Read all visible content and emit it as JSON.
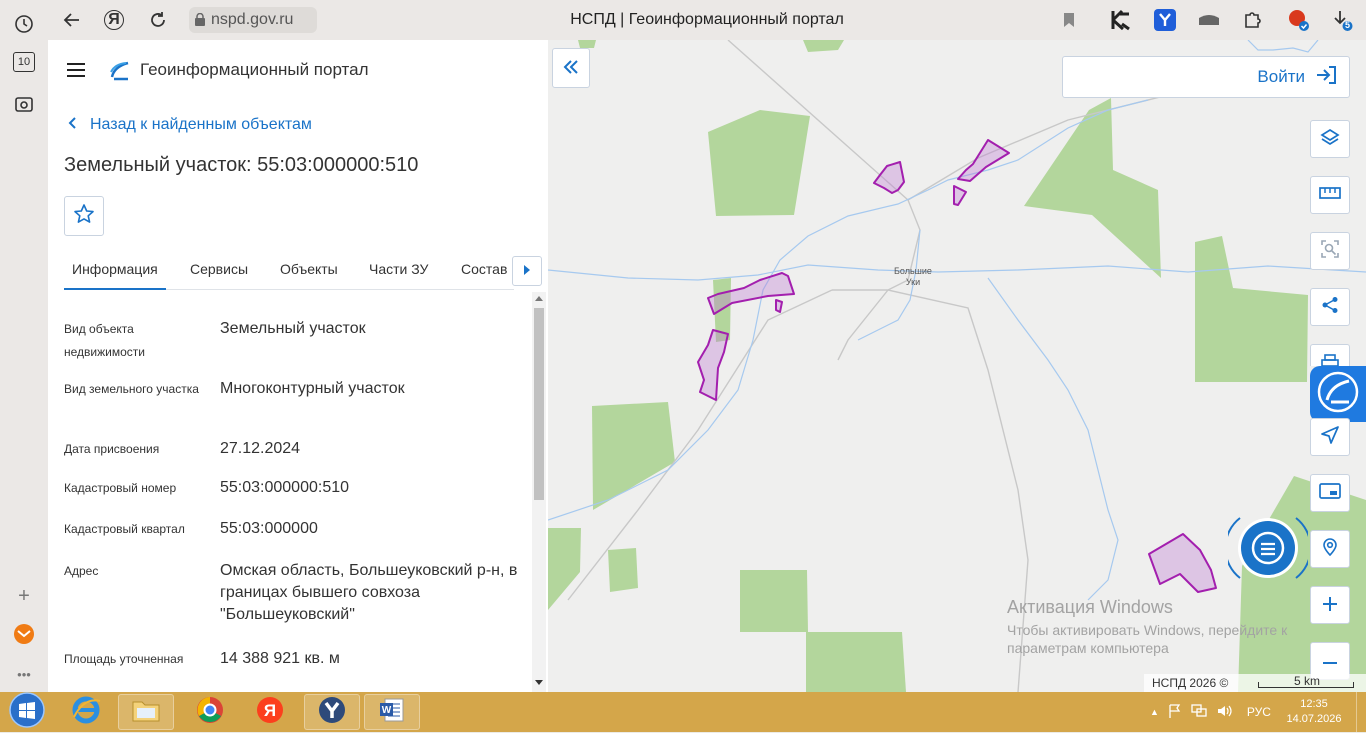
{
  "browser": {
    "url": "nspd.gov.ru",
    "tab_title": "НСПД | Геоинформационный портал",
    "tab_count": "10",
    "download_badge": "5"
  },
  "panel": {
    "app_title": "Геоинформационный портал",
    "back_label": "Назад к найденным объектам",
    "object_title": "Земельный участок: 55:03:000000:510",
    "tabs": [
      {
        "label": "Информация"
      },
      {
        "label": "Сервисы"
      },
      {
        "label": "Объекты"
      },
      {
        "label": "Части ЗУ"
      },
      {
        "label": "Состав"
      }
    ],
    "properties": [
      {
        "label": "Вид объекта недвижимости",
        "value": "Земельный участок"
      },
      {
        "label": "Вид земельного участка",
        "value": "Многоконтурный участок"
      },
      {
        "label": "Дата присвоения",
        "value": "27.12.2024"
      },
      {
        "label": "Кадастровый номер",
        "value": "55:03:000000:510"
      },
      {
        "label": "Кадастровый квартал",
        "value": "55:03:000000"
      },
      {
        "label": "Адрес",
        "value": "Омская область, Большеуковский р-н, в границах бывшего совхоза \"Большеуковский\""
      },
      {
        "label": "Площадь уточненная",
        "value": "14 388 921 кв. м"
      }
    ]
  },
  "map": {
    "login_label": "Войти",
    "place_label_line1": "Большие",
    "place_label_line2": "Уки",
    "watermark_title": "Активация Windows",
    "watermark_line1": "Чтобы активировать Windows, перейдите к",
    "watermark_line2": "параметрам компьютера",
    "copyright": "НСПД 2026 ©",
    "scale_label": "5 km",
    "colors": {
      "forest": "#b3d69c",
      "parcel": "#a31fae",
      "road": "#c8c8c8",
      "river": "#a6c9ef",
      "accent": "#1a73c8"
    }
  },
  "taskbar": {
    "language": "РУС",
    "time": "12:35",
    "date": "14.07.2026"
  }
}
